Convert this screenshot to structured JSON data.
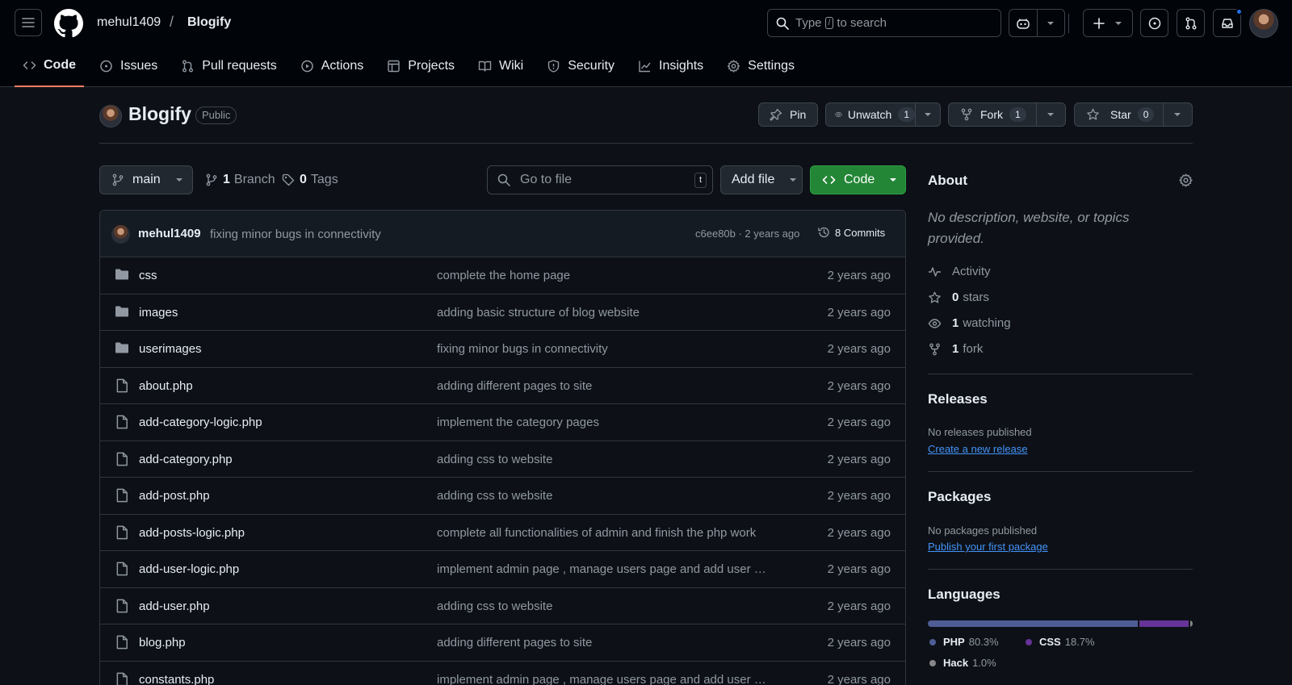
{
  "header": {
    "owner": "mehul1409",
    "slash": "/",
    "repo": "Blogify",
    "search_prefix": "Type",
    "search_key": "/",
    "search_suffix": "to search"
  },
  "nav": {
    "tabs": [
      {
        "label": "Code",
        "icon": "code-icon"
      },
      {
        "label": "Issues",
        "icon": "issue-icon"
      },
      {
        "label": "Pull requests",
        "icon": "pull-request-icon"
      },
      {
        "label": "Actions",
        "icon": "play-icon"
      },
      {
        "label": "Projects",
        "icon": "table-icon"
      },
      {
        "label": "Wiki",
        "icon": "book-icon"
      },
      {
        "label": "Security",
        "icon": "shield-icon"
      },
      {
        "label": "Insights",
        "icon": "graph-icon"
      },
      {
        "label": "Settings",
        "icon": "gear-icon"
      }
    ]
  },
  "repo": {
    "name": "Blogify",
    "visibility": "Public",
    "pin_label": "Pin",
    "watch_label": "Unwatch",
    "watch_count": "1",
    "fork_label": "Fork",
    "fork_count": "1",
    "star_label": "Star",
    "star_count": "0"
  },
  "toolbar": {
    "branch": "main",
    "branch_count": "1",
    "branch_label": "Branch",
    "tag_count": "0",
    "tag_label": "Tags",
    "goto_placeholder": "Go to file",
    "goto_key": "t",
    "add_file_label": "Add file",
    "code_label": "Code"
  },
  "commit": {
    "author": "mehul1409",
    "message": "fixing minor bugs in connectivity",
    "hash_time": "c6ee80b · 2 years ago",
    "commits_label": "8 Commits"
  },
  "files": [
    {
      "name": "css",
      "type": "dir",
      "message": "complete the home page",
      "date": "2 years ago"
    },
    {
      "name": "images",
      "type": "dir",
      "message": "adding basic structure of blog website",
      "date": "2 years ago"
    },
    {
      "name": "userimages",
      "type": "dir",
      "message": "fixing minor bugs in connectivity",
      "date": "2 years ago"
    },
    {
      "name": "about.php",
      "type": "file",
      "message": "adding different pages to site",
      "date": "2 years ago"
    },
    {
      "name": "add-category-logic.php",
      "type": "file",
      "message": "implement the category pages",
      "date": "2 years ago"
    },
    {
      "name": "add-category.php",
      "type": "file",
      "message": "adding css to website",
      "date": "2 years ago"
    },
    {
      "name": "add-post.php",
      "type": "file",
      "message": "adding css to website",
      "date": "2 years ago"
    },
    {
      "name": "add-posts-logic.php",
      "type": "file",
      "message": "complete all functionalities of admin and finish the php work",
      "date": "2 years ago"
    },
    {
      "name": "add-user-logic.php",
      "type": "file",
      "message": "implement admin page , manage users page and add user …",
      "date": "2 years ago"
    },
    {
      "name": "add-user.php",
      "type": "file",
      "message": "adding css to website",
      "date": "2 years ago"
    },
    {
      "name": "blog.php",
      "type": "file",
      "message": "adding different pages to site",
      "date": "2 years ago"
    },
    {
      "name": "constants.php",
      "type": "file",
      "message": "implement admin page , manage users page and add user …",
      "date": "2 years ago"
    }
  ],
  "about": {
    "heading": "About",
    "description": "No description, website, or topics provided.",
    "activity_label": "Activity",
    "stars_count": "0",
    "stars_label": "stars",
    "watching_count": "1",
    "watching_label": "watching",
    "fork_count": "1",
    "fork_label": "fork"
  },
  "releases": {
    "heading": "Releases",
    "empty": "No releases published",
    "link": "Create a new release"
  },
  "packages": {
    "heading": "Packages",
    "empty": "No packages published",
    "link": "Publish your first package"
  },
  "languages": {
    "heading": "Languages",
    "items": [
      {
        "name": "PHP",
        "percent": "80.3%",
        "value": 80.3,
        "color": "#4F5D95"
      },
      {
        "name": "CSS",
        "percent": "18.7%",
        "value": 18.7,
        "color": "#663399"
      },
      {
        "name": "Hack",
        "percent": "1.0%",
        "value": 1.0,
        "color": "#878787"
      }
    ]
  },
  "colors": {
    "accent_tab": "#f78166",
    "code_button": "#238636",
    "link": "#4493f8",
    "notification": "#1f6feb"
  }
}
